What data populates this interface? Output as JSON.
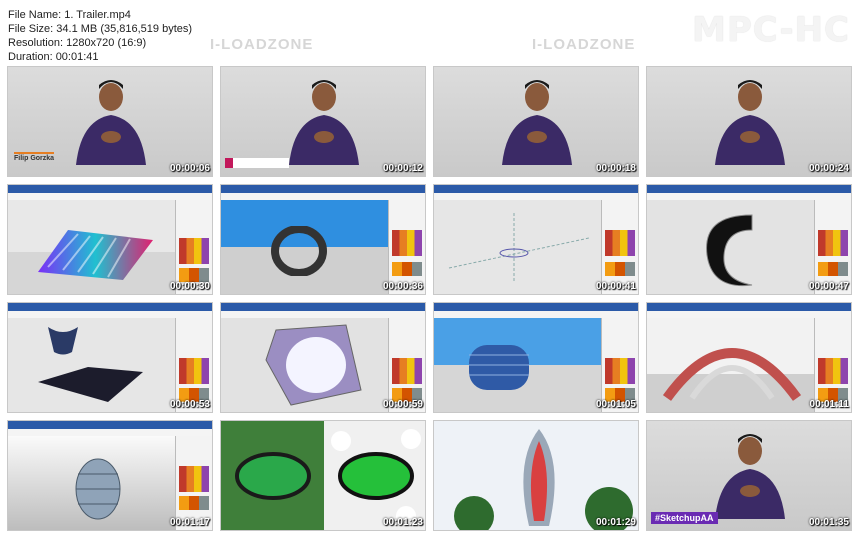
{
  "file_info": {
    "name": "File Name: 1. Trailer.mp4",
    "size": "File Size: 34.1 MB (35,816,519 bytes)",
    "resolution": "Resolution: 1280x720 (16:9)",
    "duration": "Duration: 00:01:41"
  },
  "logo": "MPC-HC",
  "watermark": "I-LOADZONE",
  "presenter_name": "Filip Gorzka",
  "hashtag": "#SketchupAA",
  "thumbnails": [
    {
      "time": "00:00:06"
    },
    {
      "time": "00:00:12"
    },
    {
      "time": "00:00:18"
    },
    {
      "time": "00:00:24"
    },
    {
      "time": "00:00:30"
    },
    {
      "time": "00:00:36"
    },
    {
      "time": "00:00:41"
    },
    {
      "time": "00:00:47"
    },
    {
      "time": "00:00:53"
    },
    {
      "time": "00:00:59"
    },
    {
      "time": "00:01:05"
    },
    {
      "time": "00:01:11"
    },
    {
      "time": "00:01:17"
    },
    {
      "time": "00:01:23"
    },
    {
      "time": "00:01:29"
    },
    {
      "time": "00:01:35"
    }
  ]
}
